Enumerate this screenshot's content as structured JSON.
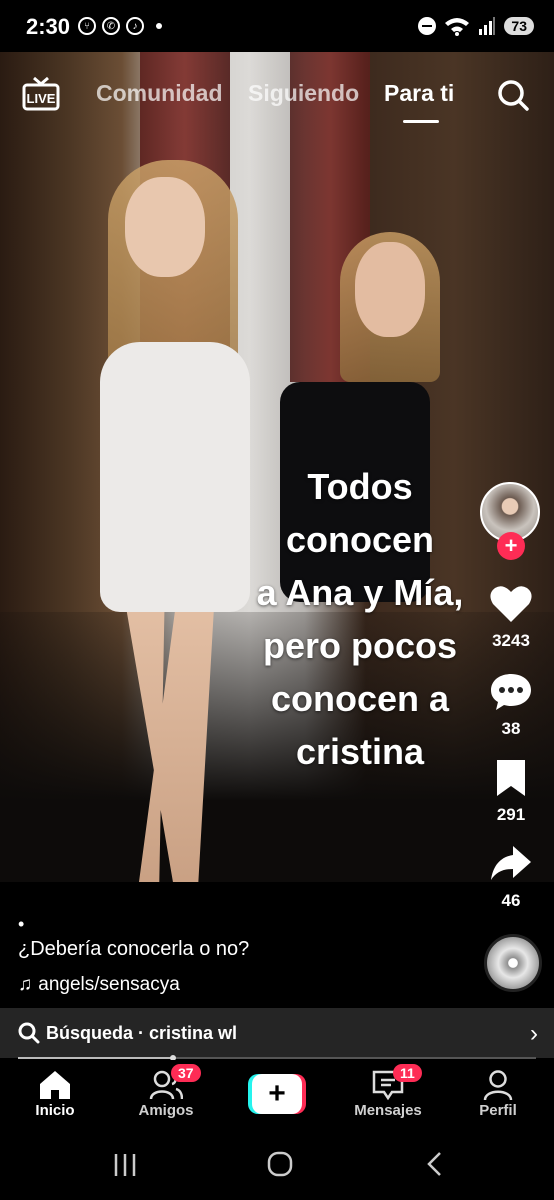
{
  "status_bar": {
    "time": "2:30",
    "battery": "73"
  },
  "top_nav": {
    "live_label": "LIVE",
    "tabs": [
      {
        "label": "Comunidad"
      },
      {
        "label": "Siguiendo"
      },
      {
        "label": "Para ti"
      }
    ],
    "active_tab": "Para ti"
  },
  "video": {
    "overlay_lines": [
      "Todos",
      "conocen",
      "a Ana y Mía,",
      "pero pocos",
      "conocen a",
      "cristina"
    ]
  },
  "actions": {
    "likes": "3243",
    "comments": "38",
    "saves": "291",
    "shares": "46"
  },
  "post": {
    "dot": "•",
    "caption": "¿Debería conocerla o no?",
    "music": "angels/sensacya"
  },
  "search_bar": {
    "text": "Búsqueda · cristina wl"
  },
  "playback": {
    "progress_fraction": 0.3
  },
  "bottom_nav": {
    "items": [
      {
        "label": "Inicio"
      },
      {
        "label": "Amigos",
        "badge": "37"
      },
      {
        "label": "+"
      },
      {
        "label": "Mensajes",
        "badge": "11"
      },
      {
        "label": "Perfil"
      }
    ]
  },
  "colors": {
    "accent": "#fe2c55",
    "cyan": "#25f4ee"
  }
}
